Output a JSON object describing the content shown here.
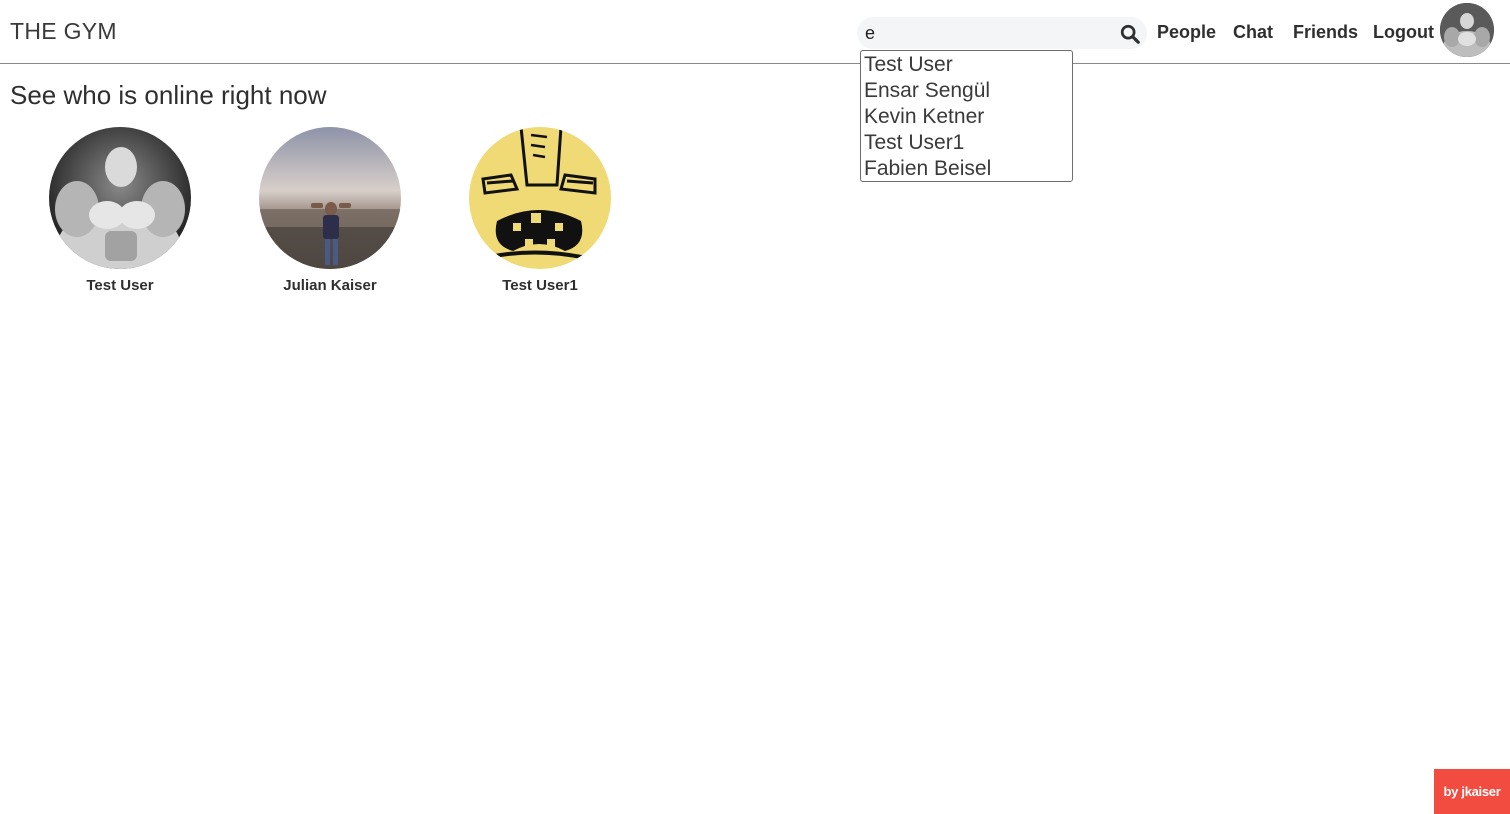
{
  "header": {
    "brand": "THE GYM",
    "search": {
      "value": "e",
      "placeholder": ""
    },
    "nav": [
      "People",
      "Chat",
      "Friends",
      "Logout"
    ]
  },
  "dropdown": {
    "suggestions": [
      "Test User",
      "Ensar Sengül",
      "Kevin Ketner",
      "Test User1",
      "Fabien Beisel"
    ]
  },
  "main": {
    "title": "See who is online right now",
    "users": [
      {
        "name": "Test User",
        "avatar": "bodybuilder-photo"
      },
      {
        "name": "Julian Kaiser",
        "avatar": "city-skyline-photo"
      },
      {
        "name": "Test User1",
        "avatar": "cartoon-face"
      }
    ]
  },
  "badge": {
    "label": "by jkaiser",
    "color": "#f24b3f"
  }
}
